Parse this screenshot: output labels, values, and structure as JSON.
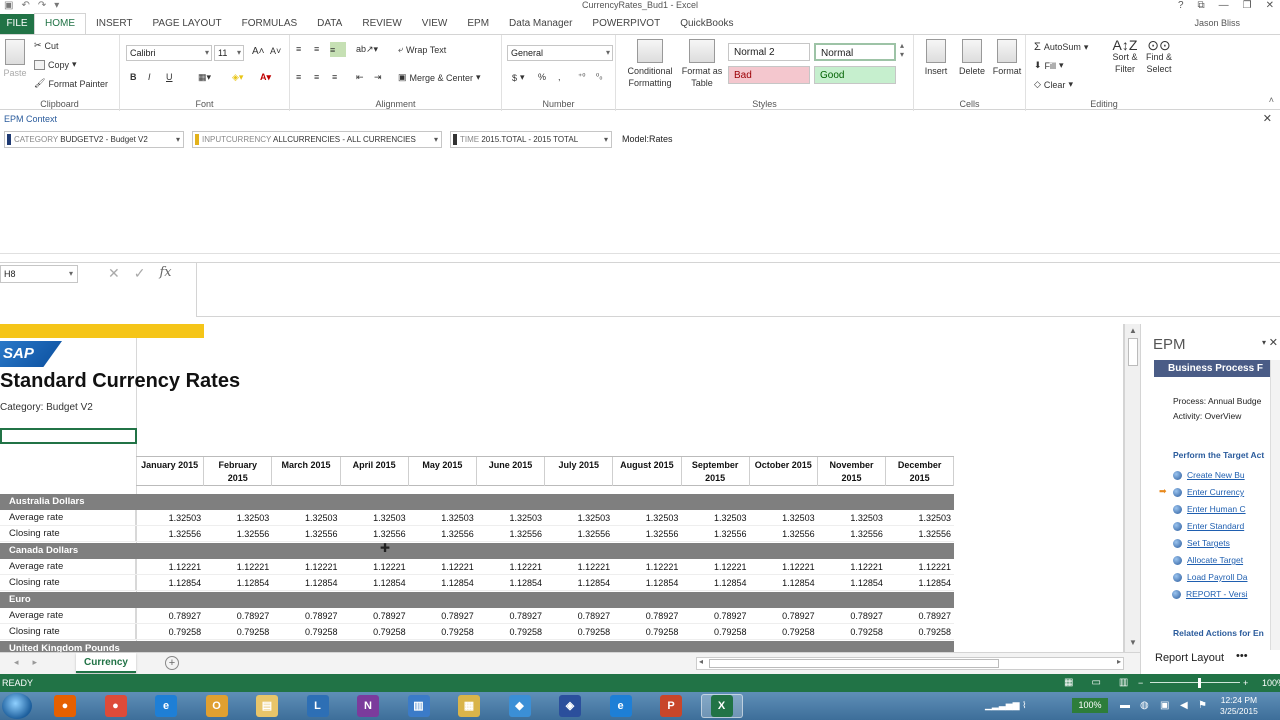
{
  "window": {
    "title": "CurrencyRates_Bud1 - Excel",
    "user": "Jason Bliss",
    "qat_icons": [
      "save-icon",
      "undo-icon",
      "redo-icon",
      "customize-icon"
    ],
    "controls": [
      "?",
      "⧉",
      "—",
      "❐",
      "✕"
    ]
  },
  "tabs": [
    {
      "label": "FILE",
      "kind": "file"
    },
    {
      "label": "HOME",
      "kind": "active"
    },
    {
      "label": "INSERT"
    },
    {
      "label": "PAGE LAYOUT"
    },
    {
      "label": "FORMULAS"
    },
    {
      "label": "DATA"
    },
    {
      "label": "REVIEW"
    },
    {
      "label": "VIEW"
    },
    {
      "label": "EPM"
    },
    {
      "label": "Data Manager"
    },
    {
      "label": "POWERPIVOT"
    },
    {
      "label": "QuickBooks"
    }
  ],
  "ribbon": {
    "clipboard": {
      "label": "Clipboard",
      "paste": "Paste",
      "cut": "Cut",
      "copy": "Copy",
      "format_painter": "Format Painter"
    },
    "font": {
      "label": "Font",
      "name": "Calibri",
      "size": "11",
      "bold": "B",
      "italic": "I",
      "underline": "U"
    },
    "alignment": {
      "label": "Alignment",
      "wrap": "Wrap Text",
      "merge": "Merge & Center"
    },
    "number": {
      "label": "Number",
      "format": "General",
      "currency": "$",
      "percent": "%",
      "comma": ","
    },
    "styles": {
      "label": "Styles",
      "conditional": "Conditional Formatting",
      "format_table": "Format as Table",
      "normal2": "Normal 2",
      "normal": "Normal",
      "bad": "Bad",
      "good": "Good"
    },
    "cells": {
      "label": "Cells",
      "insert": "Insert",
      "delete": "Delete",
      "format": "Format"
    },
    "editing": {
      "label": "Editing",
      "autosum": "AutoSum",
      "fill": "Fill",
      "clear": "Clear",
      "sort_filter": "Sort & Filter",
      "find_select": "Find & Select"
    }
  },
  "epm_context": {
    "label": "EPM Context",
    "dims": [
      {
        "title": "CATEGORY",
        "value": "BUDGETV2 - Budget V2"
      },
      {
        "title": "INPUTCURRENCY",
        "value": "ALLCURRENCIES - ALL CURRENCIES"
      },
      {
        "title": "TIME",
        "value": "2015.TOTAL - 2015 TOTAL"
      }
    ],
    "model": "Model:Rates"
  },
  "formula_bar": {
    "namebox": "H8",
    "fx": "fx"
  },
  "sheet": {
    "logo": "SAP",
    "title": "Standard Currency Rates",
    "subtitle": "Category: Budget V2",
    "months": [
      [
        "January 2015",
        ""
      ],
      [
        "February",
        "2015"
      ],
      [
        "March 2015",
        ""
      ],
      [
        "April 2015",
        ""
      ],
      [
        "May 2015",
        ""
      ],
      [
        "June 2015",
        ""
      ],
      [
        "July 2015",
        ""
      ],
      [
        "August 2015",
        ""
      ],
      [
        "September",
        "2015"
      ],
      [
        "October 2015",
        ""
      ],
      [
        "November",
        "2015"
      ],
      [
        "December",
        "2015"
      ]
    ],
    "groups": [
      {
        "name": "Australia Dollars",
        "rows": [
          {
            "label": "Average rate",
            "value": "1.32503"
          },
          {
            "label": "Closing rate",
            "value": "1.32556"
          }
        ]
      },
      {
        "name": "Canada Dollars",
        "rows": [
          {
            "label": "Average rate",
            "value": "1.12221"
          },
          {
            "label": "Closing rate",
            "value": "1.12854"
          }
        ]
      },
      {
        "name": "Euro",
        "rows": [
          {
            "label": "Average rate",
            "value": "0.78927"
          },
          {
            "label": "Closing rate",
            "value": "0.79258"
          }
        ]
      },
      {
        "name": "United Kingdom Pounds",
        "rows": []
      }
    ],
    "tab": "Currency"
  },
  "epm_pane": {
    "title": "EPM",
    "header": "Business Process F",
    "process": "Process: Annual Budge",
    "activity": "Activity: OverView",
    "perform": "Perform the Target Act",
    "actions": [
      "Create New Bu",
      "Enter Currency",
      "Enter Human C",
      "Enter Standard",
      "Set Targets",
      "Allocate Target",
      "Load Payroll Da",
      "REPORT - Versi"
    ],
    "related": "Related Actions for En",
    "report_layout": "Report Layout",
    "more": "•••"
  },
  "status": {
    "ready": "READY",
    "zoom": "100%",
    "zoom_value_pct": 100
  },
  "taskbar": {
    "apps": [
      {
        "name": "firefox-icon",
        "color": "#e66000",
        "glyph": "●"
      },
      {
        "name": "chrome-icon",
        "color": "#dd4b39",
        "glyph": "●"
      },
      {
        "name": "ie-icon",
        "color": "#1e7fd6",
        "glyph": "e"
      },
      {
        "name": "outlook-icon",
        "color": "#e0a030",
        "glyph": "O"
      },
      {
        "name": "explorer-icon",
        "color": "#e8c56a",
        "glyph": "▤"
      },
      {
        "name": "lync-icon",
        "color": "#2d6fb5",
        "glyph": "L"
      },
      {
        "name": "onenote-icon",
        "color": "#7b3b9c",
        "glyph": "N"
      },
      {
        "name": "book-icon",
        "color": "#3b7bc8",
        "glyph": "▥"
      },
      {
        "name": "folder-icon",
        "color": "#d9b44a",
        "glyph": "▦"
      },
      {
        "name": "tool-icon",
        "color": "#3b8fd6",
        "glyph": "◆"
      },
      {
        "name": "network-icon",
        "color": "#2b4f9c",
        "glyph": "◈"
      },
      {
        "name": "ie2-icon",
        "color": "#1e7fd6",
        "glyph": "e"
      },
      {
        "name": "powerpoint-icon",
        "color": "#c8462a",
        "glyph": "P"
      },
      {
        "name": "excel-icon",
        "color": "#217346",
        "glyph": "X"
      }
    ],
    "battery_pct": "100%",
    "time": "12:24 PM",
    "date": "3/25/2015"
  }
}
